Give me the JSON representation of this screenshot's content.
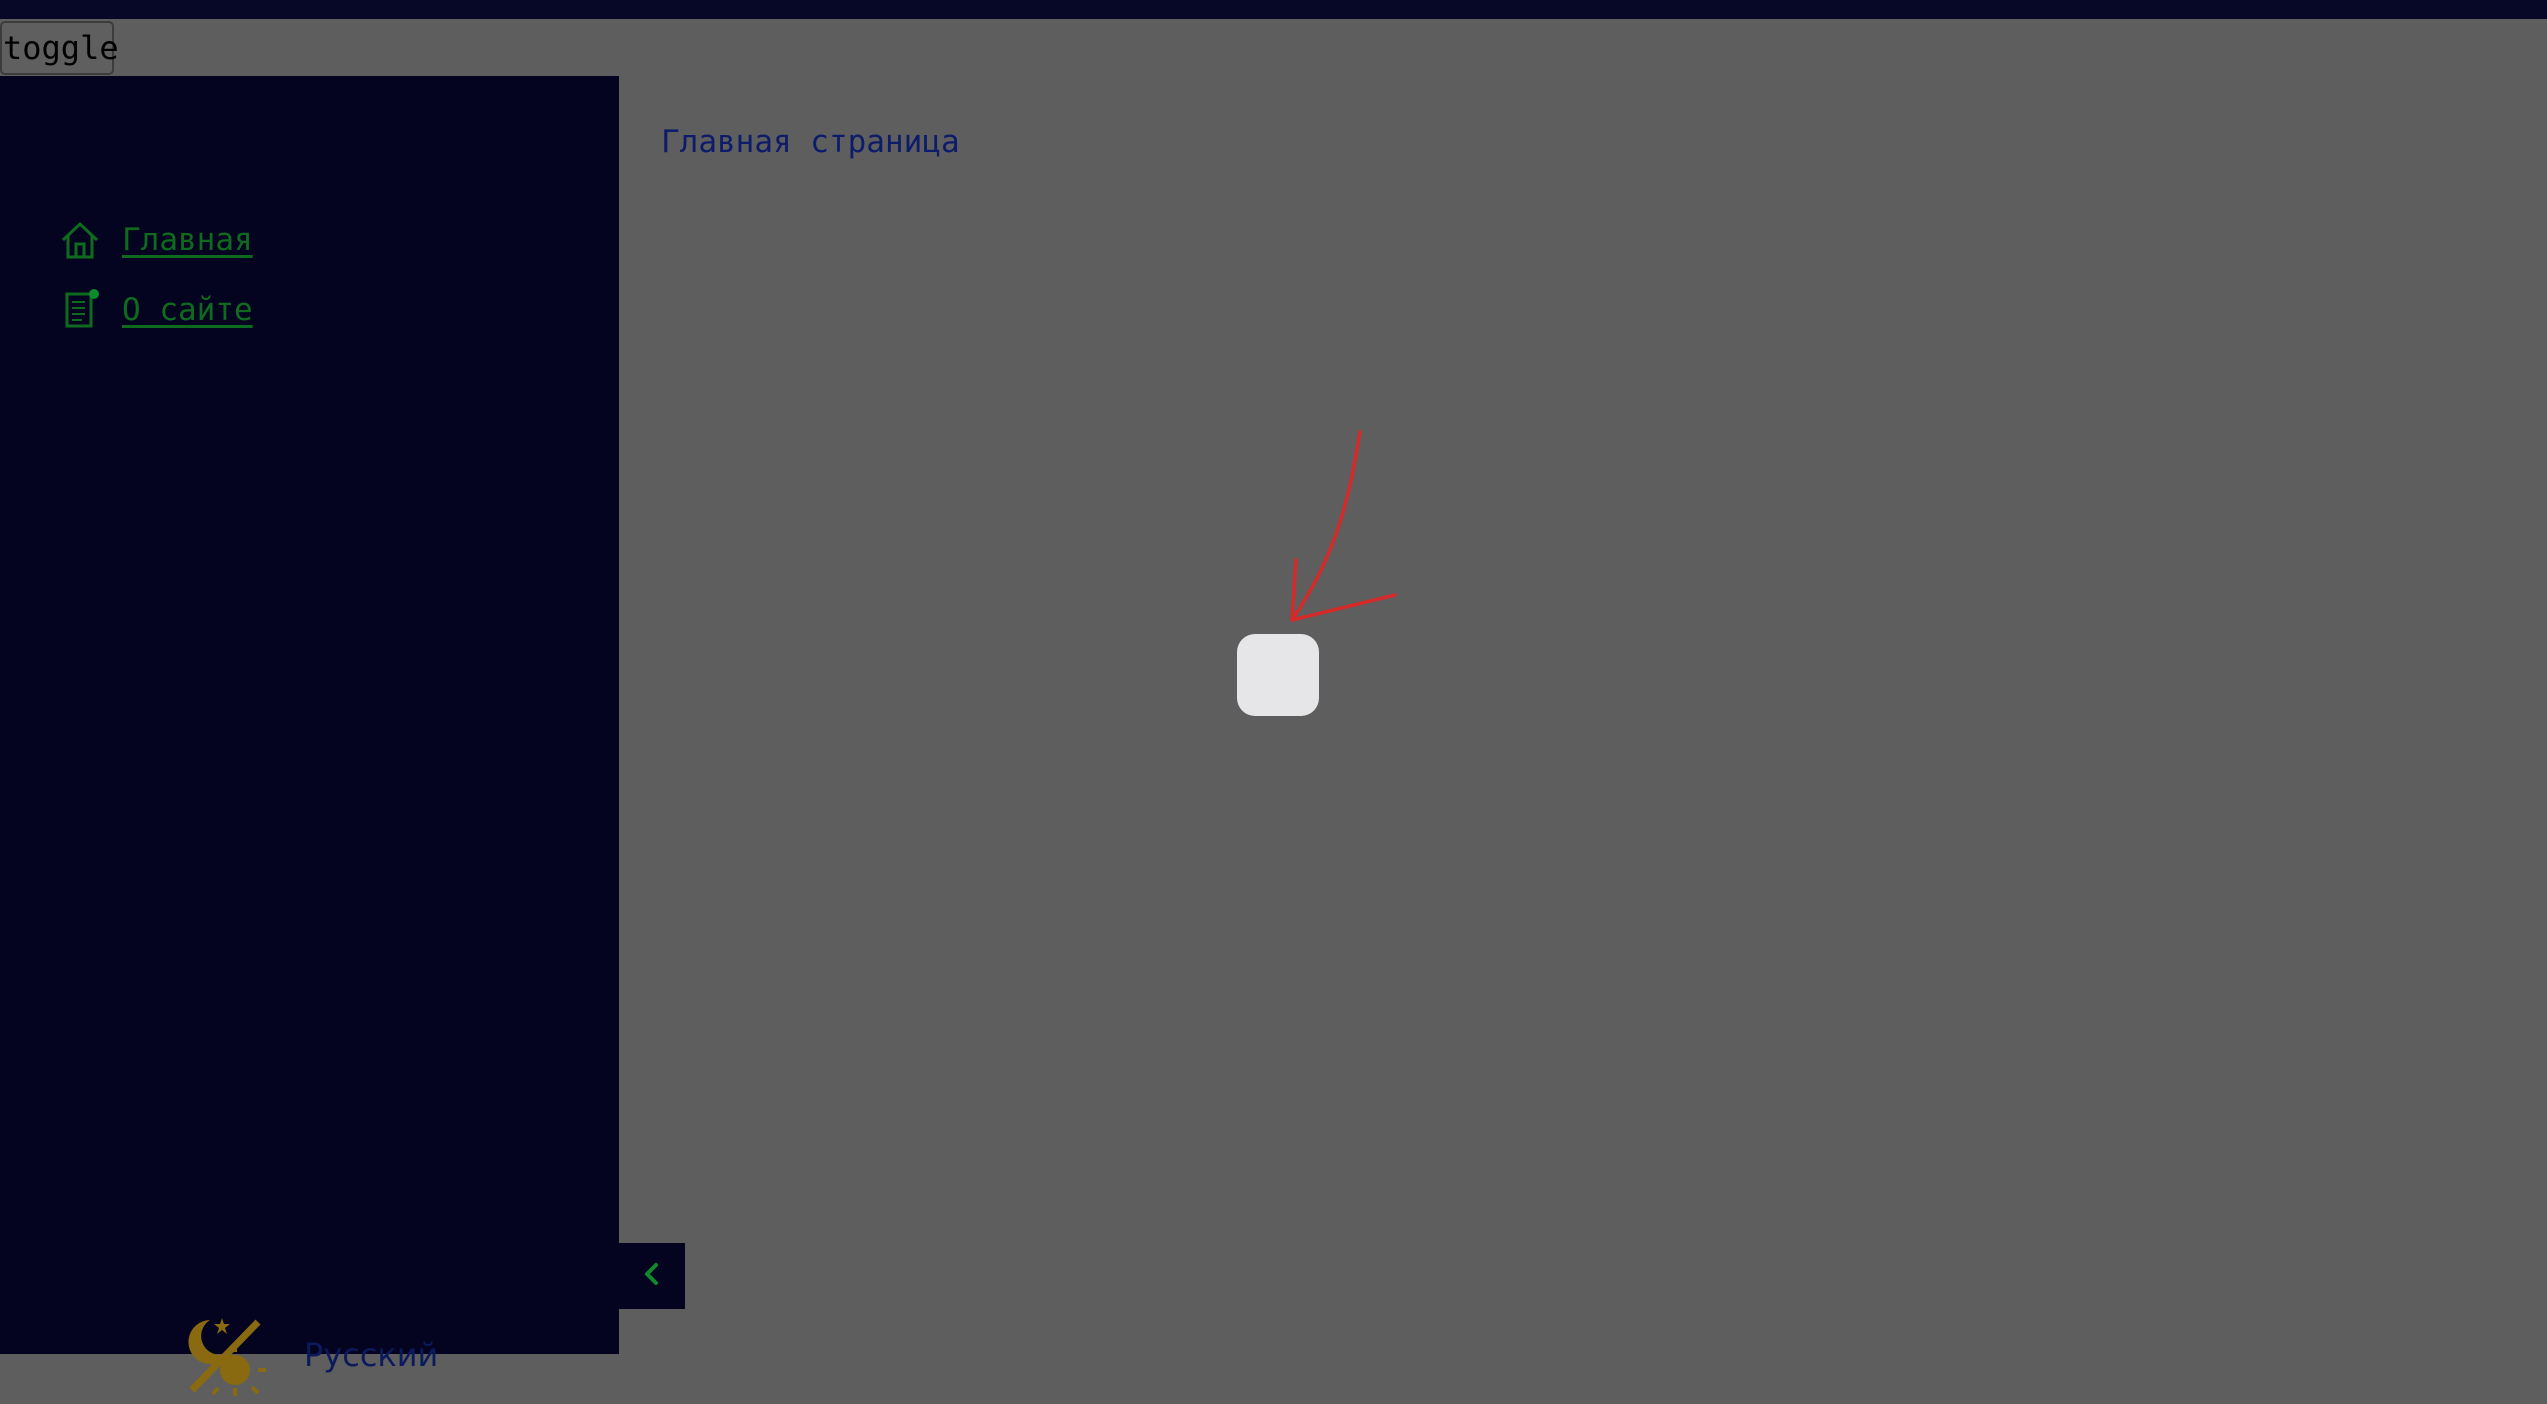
{
  "toggle": {
    "label": "toggle"
  },
  "sidebar": {
    "items": [
      {
        "label": "Главная",
        "icon": "home-icon"
      },
      {
        "label": "О сайте",
        "icon": "document-icon"
      }
    ],
    "footer": {
      "theme_icon": "theme-switch-icon",
      "language": "Русский"
    },
    "collapse_icon": "chevron-left-icon"
  },
  "main": {
    "title": "Главная страница",
    "loader_icon": "loading-square"
  },
  "colors": {
    "topbar": "#070728",
    "sidebar_bg": "#040320",
    "main_bg": "#5e5e5e",
    "nav_link": "#0e6b1e",
    "title_text": "#0c1c6a",
    "annotation_arrow": "#d42a2a",
    "theme_icon": "#8a6a10"
  }
}
